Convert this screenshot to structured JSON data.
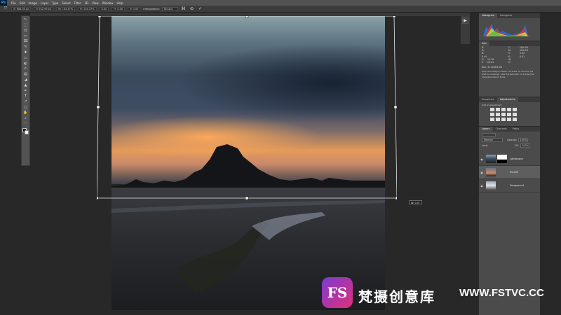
{
  "app": {
    "logo": "Ps"
  },
  "menubar": {
    "items": [
      "File",
      "Edit",
      "Image",
      "Layer",
      "Type",
      "Select",
      "Filter",
      "3D",
      "View",
      "Window",
      "Help"
    ]
  },
  "options": {
    "x": "X: 608.00 px",
    "y": "Y: 502.95 px",
    "w": "W: 104.37%",
    "h": "H: 104.37%",
    "angle": "0.00",
    "hskew": "H: 0.00",
    "vskew": "V: 0.00",
    "interp_label": "Interpolation:",
    "interp_value": "Bicubic"
  },
  "tools": [
    "↖",
    "⬚",
    "ʘ",
    "✂",
    "⌧",
    "✎",
    "✚",
    "▭",
    "◐",
    "✍",
    "▤",
    "◢",
    "▲",
    "✒",
    "T",
    "↗",
    "◻",
    "✋",
    "⌕",
    "⋯"
  ],
  "transform_tooltip": "W: 0.0°",
  "rightpanel": {
    "histogram_tabs": [
      "Histogram",
      "Navigator"
    ],
    "info_tabs": [
      "Info"
    ],
    "info": {
      "r": "R:",
      "g": "G:",
      "b": "B:",
      "rgb_bits": "8-bit",
      "c": "C:",
      "c_val": "100.0%",
      "m": "M:",
      "m_val": "100.0%",
      "y": "Y:",
      "y_val": "0.02",
      "k": "K:",
      "k_val": "0.01",
      "x": "X:",
      "xv": "13.76",
      "yl": "Y:",
      "yv": "24.01",
      "w": "W:",
      "h": "H:",
      "doc": "Doc: 31.4M/83.1M",
      "hint": "Click and drag to rotate. Hit enter to commit. Hit shift to constrain. Use the spacebar to access the navigation/zoom tools."
    },
    "adjust_tabs": [
      "Properties",
      "Adjustments"
    ],
    "adjust_hint": "Add an adjustment",
    "layers_tabs": [
      "Layers",
      "Channels",
      "Paths"
    ],
    "blend": "Normal",
    "opacity_label": "Opacity:",
    "opacity_value": "100%",
    "lock_label": "Lock:",
    "fill_label": "Fill:",
    "fill_value": "100%",
    "layers": [
      {
        "name": "Landscape"
      },
      {
        "name": "Sunset"
      },
      {
        "name": "Foreground"
      }
    ]
  },
  "watermark": {
    "logo": "FS",
    "cn": "梵摄创意库",
    "url": "WWW.FSTVC.CC"
  }
}
